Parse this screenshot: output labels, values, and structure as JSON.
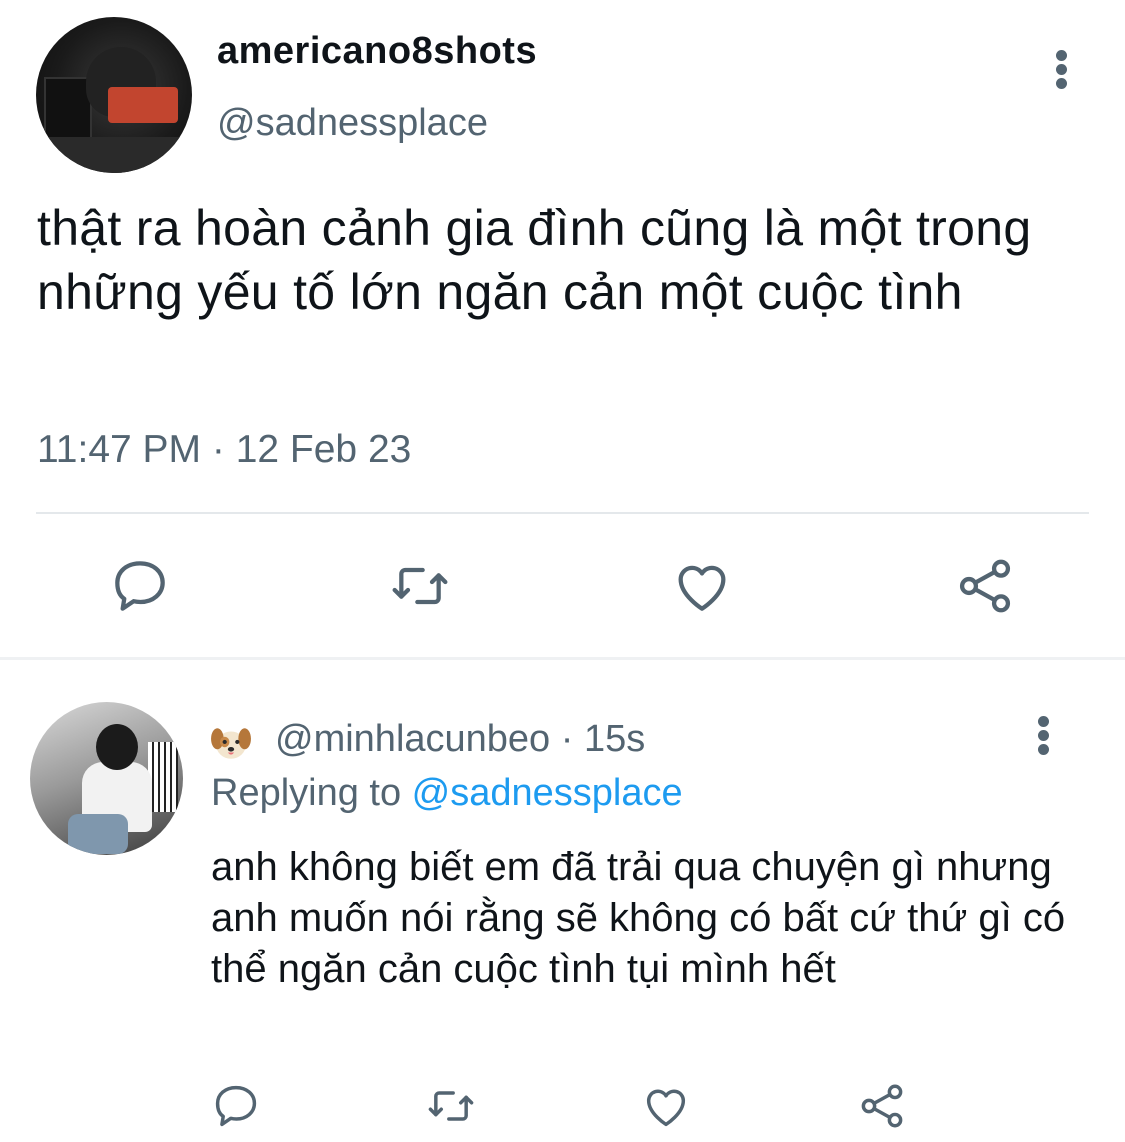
{
  "main_tweet": {
    "display_name": "americano8shots",
    "handle": "@sadnessplace",
    "text": "thật ra hoàn cảnh gia đình cũng là một trong những yếu tố lớn ngăn cản một cuộc tình",
    "timestamp": "11:47 PM · 12 Feb 23",
    "actions": [
      "reply-icon",
      "retweet-icon",
      "like-icon",
      "share-icon"
    ]
  },
  "reply": {
    "emoji": "dog-face-icon",
    "handle": "@minhlacunbeo",
    "separator": " · ",
    "time": "15s",
    "replying_prefix": "Replying to ",
    "replying_to": "@sadnessplace",
    "text": "anh không biết em đã trải qua chuyện gì nhưng anh muốn nói rằng sẽ không có bất cứ thứ gì có thể ngăn cản cuộc tình tụi mình hết",
    "actions": [
      "reply-icon",
      "retweet-icon",
      "like-icon",
      "share-icon"
    ]
  },
  "colors": {
    "text": "#0f1419",
    "secondary": "#536471",
    "link": "#1d9bf0",
    "divider": "#e4e8eb"
  }
}
